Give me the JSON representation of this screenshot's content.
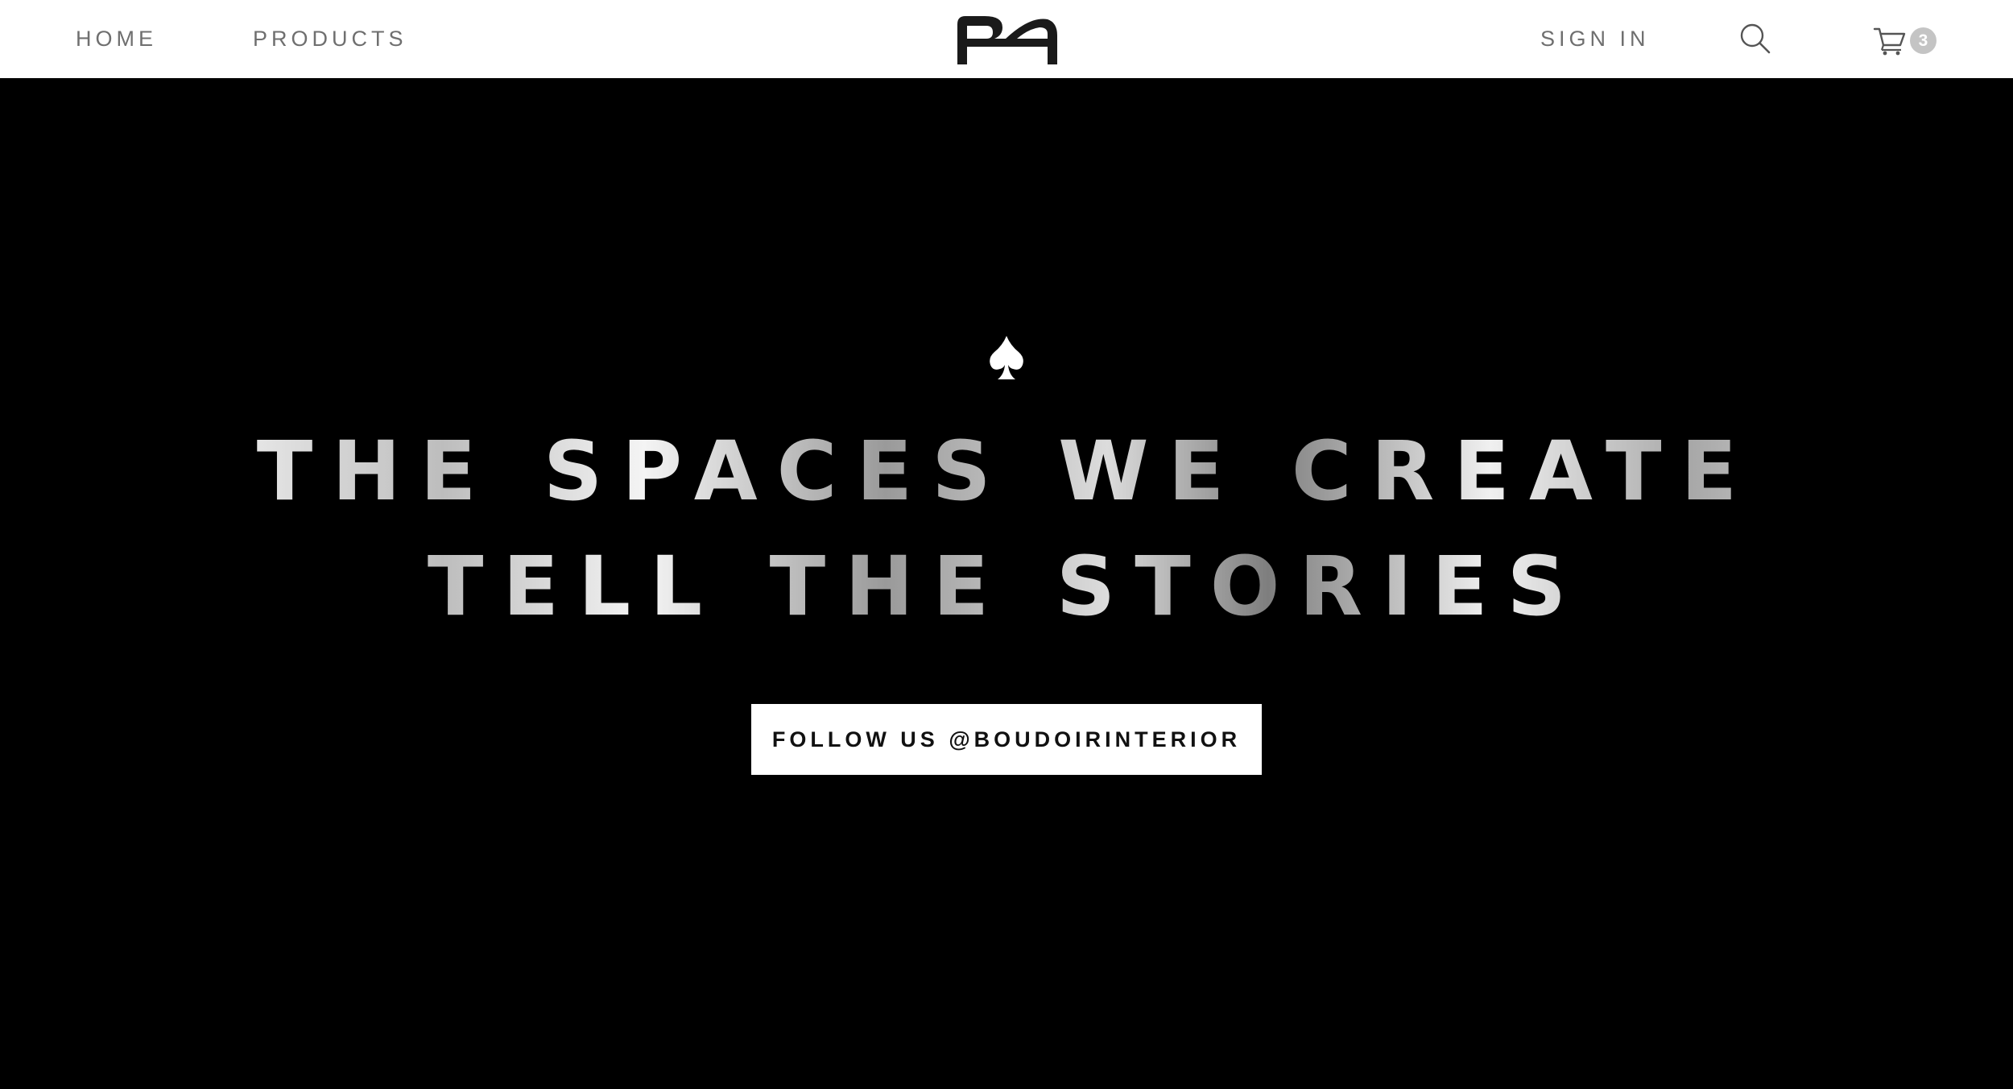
{
  "header": {
    "nav": {
      "home_label": "HOME",
      "products_label": "PRODUCTS",
      "signin_label": "SIGN IN"
    },
    "logo_icon": "boudoir-b-logo",
    "search_icon": "search-icon",
    "cart": {
      "icon": "cart-icon",
      "count": "3",
      "badge_color": "#c4c4c4"
    }
  },
  "hero": {
    "ornament_icon": "spade-icon",
    "headline_line_1": "THE SPACES WE CREATE",
    "headline_line_2": "TELL THE STORIES",
    "cta_label": "FOLLOW US @BOUDOIRINTERIOR",
    "background_color": "#000000",
    "cta_background": "#ffffff"
  }
}
